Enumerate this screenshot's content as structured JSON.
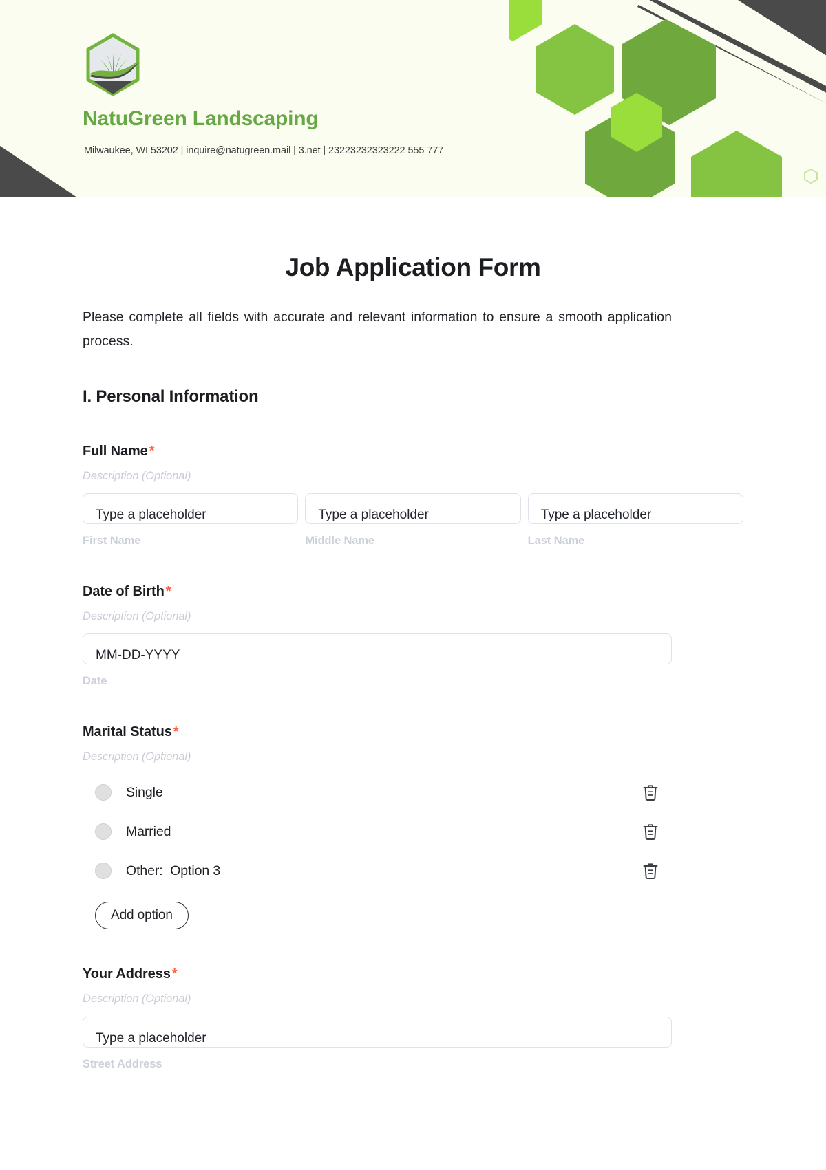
{
  "letterhead": {
    "brand_name": "NatuGreen Landscaping",
    "contact_line": "Milwaukee, WI 53202 | inquire@natugreen.mail | 3.net | 23223232323222 555 777",
    "logo_icon": "hexagon-grass-logo",
    "accent_green": "#8dc63f",
    "brand_green": "#66a843",
    "deep_green": "#6fa83c",
    "dark_gray": "#4a4a4a",
    "banner_bg": "#fbfdf0"
  },
  "form": {
    "title": "Job Application Form",
    "description": "Please complete all fields with accurate and relevant information to ensure a smooth application process.",
    "sections": [
      {
        "heading": "I. Personal Information",
        "fields": [
          {
            "label": "Full Name",
            "required_mark": "*",
            "description": "Description (Optional)",
            "type": "name-group",
            "inputs": [
              {
                "placeholder": "Type a placeholder",
                "sub_label": "First Name"
              },
              {
                "placeholder": "Type a placeholder",
                "sub_label": "Middle Name"
              },
              {
                "placeholder": "Type a placeholder",
                "sub_label": "Last Name"
              }
            ]
          },
          {
            "label": "Date of Birth",
            "required_mark": "*",
            "description": "Description (Optional)",
            "type": "date",
            "placeholder": "MM-DD-YYYY",
            "sub_label": "Date"
          },
          {
            "label": "Marital Status",
            "required_mark": "*",
            "description": "Description (Optional)",
            "type": "radio-group",
            "options": [
              {
                "label": "Single",
                "delete_icon": "trash-icon"
              },
              {
                "label": "Married",
                "delete_icon": "trash-icon"
              },
              {
                "label": "Other:  Option 3",
                "delete_icon": "trash-icon"
              }
            ],
            "add_option_label": "Add option"
          },
          {
            "label": "Your Address",
            "required_mark": "*",
            "description": "Description (Optional)",
            "type": "address",
            "placeholder": "Type a placeholder",
            "sub_label": "Street Address"
          }
        ]
      }
    ]
  }
}
